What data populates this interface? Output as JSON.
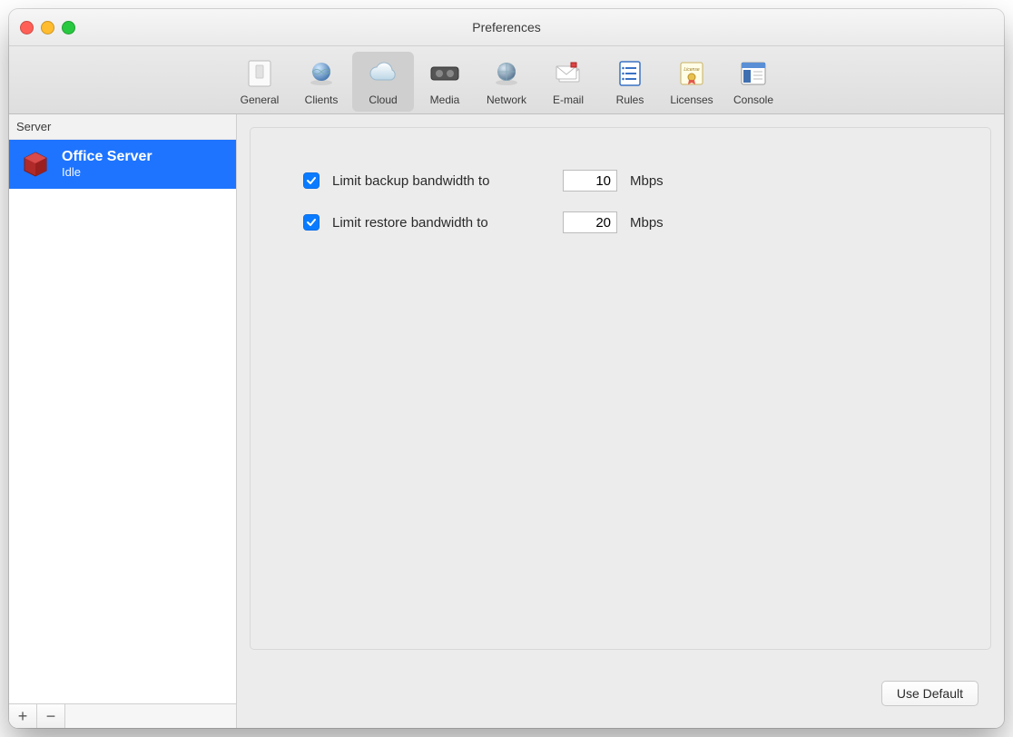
{
  "window": {
    "title": "Preferences"
  },
  "toolbar": {
    "items": [
      {
        "label": "General"
      },
      {
        "label": "Clients"
      },
      {
        "label": "Cloud"
      },
      {
        "label": "Media"
      },
      {
        "label": "Network"
      },
      {
        "label": "E-mail"
      },
      {
        "label": "Rules"
      },
      {
        "label": "Licenses"
      },
      {
        "label": "Console"
      }
    ],
    "selected_index": 2
  },
  "sidebar": {
    "header": "Server",
    "server": {
      "name": "Office Server",
      "status": "Idle"
    },
    "add_label": "+",
    "remove_label": "−"
  },
  "cloud_settings": {
    "backup": {
      "checked": true,
      "label": "Limit backup bandwidth to",
      "value": "10",
      "unit": "Mbps"
    },
    "restore": {
      "checked": true,
      "label": "Limit restore bandwidth to",
      "value": "20",
      "unit": "Mbps"
    }
  },
  "buttons": {
    "use_default": "Use Default"
  }
}
